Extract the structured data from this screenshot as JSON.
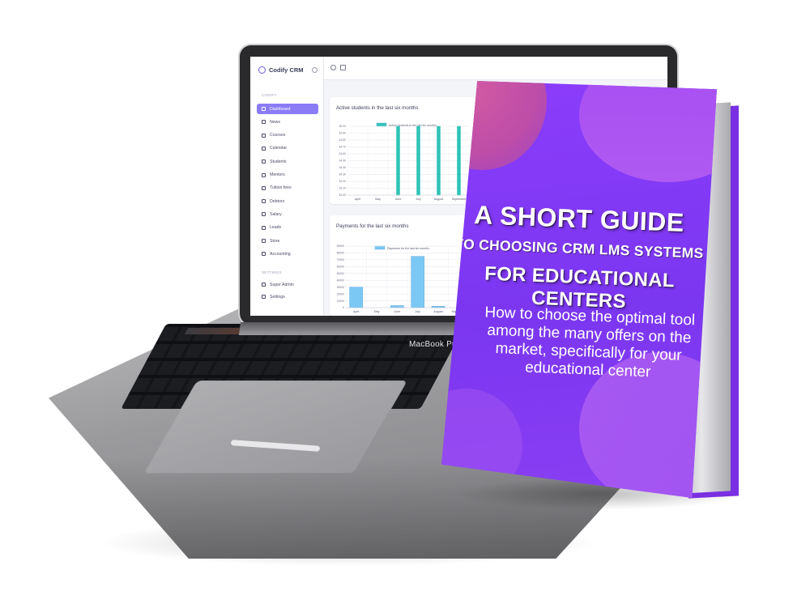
{
  "crm": {
    "app_name": "Codify CRM",
    "sections": {
      "main": "CODIFY",
      "settings": "SETTINGS"
    },
    "nav": [
      {
        "label": "Dashboard",
        "active": true
      },
      {
        "label": "News"
      },
      {
        "label": "Courses"
      },
      {
        "label": "Calendar"
      },
      {
        "label": "Students"
      },
      {
        "label": "Mentors"
      },
      {
        "label": "Tuition fees"
      },
      {
        "label": "Debtors"
      },
      {
        "label": "Salary"
      },
      {
        "label": "Leads"
      },
      {
        "label": "Store"
      },
      {
        "label": "Accounting"
      }
    ],
    "settings_nav": [
      {
        "label": "Super Admin"
      },
      {
        "label": "Settings"
      }
    ],
    "accent_color": "#8b7cf6"
  },
  "laptop": {
    "brand": "MacBook Pro"
  },
  "chart_data": [
    {
      "type": "bar",
      "title": "Active students in the last six months",
      "legend": "Active students in the last six months",
      "legend_position": "top",
      "categories": [
        "April",
        "May",
        "June",
        "July",
        "August",
        "September"
      ],
      "values": [
        0,
        0,
        35,
        35,
        35,
        35
      ],
      "yticks": [
        "35.00",
        "34.90",
        "34.80",
        "34.70",
        "34.60",
        "34.50",
        "34.40",
        "34.30",
        "34.20",
        "34.10",
        "34.00"
      ],
      "grid": true,
      "color": "#2ec4b6"
    },
    {
      "type": "bar",
      "title": "Payments for the last six months",
      "legend": "Payments for the last six months",
      "legend_position": "top",
      "categories": [
        "April",
        "May",
        "June",
        "July",
        "August",
        "September"
      ],
      "values": [
        30000,
        0,
        3000,
        75000,
        2000,
        0
      ],
      "yticks": [
        "90000",
        "80000",
        "70000",
        "60000",
        "50000",
        "40000",
        "30000",
        "20000",
        "10000",
        "0"
      ],
      "ylim": [
        0,
        90000
      ],
      "grid": true,
      "color": "#7cc8f5"
    }
  ],
  "book": {
    "title": "A SHORT GUIDE",
    "subtitle_1": "TO CHOOSING CRM LMS SYSTEMS",
    "subtitle_2": "FOR EDUCATIONAL CENTERS",
    "description": "How to choose the optimal tool among the many offers on the market, specifically for your educational center",
    "cover_color": "#7b36f0"
  }
}
